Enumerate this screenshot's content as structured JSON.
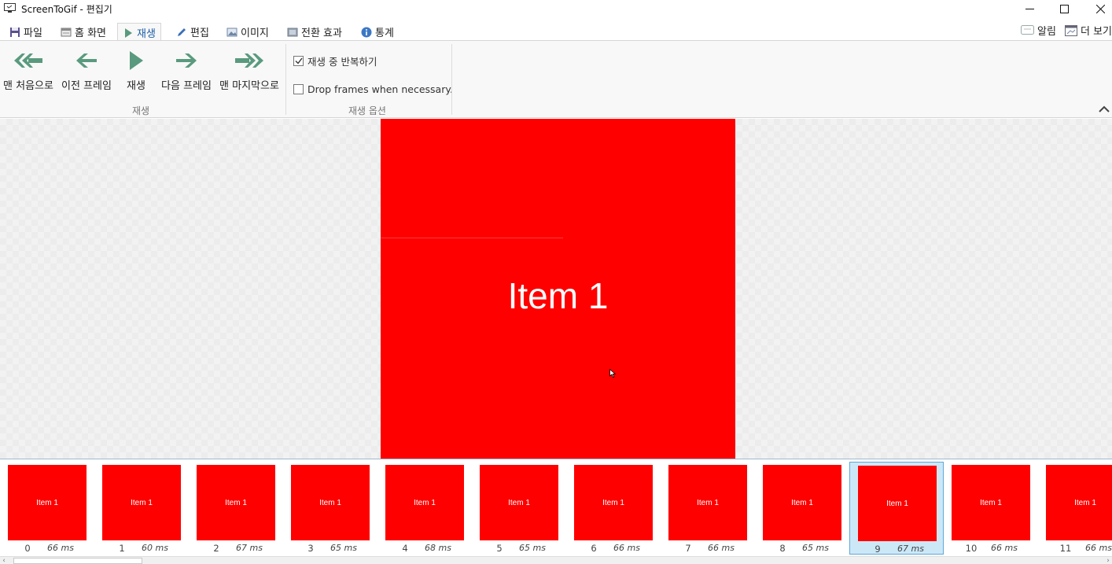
{
  "window": {
    "title": "ScreenToGif - 편집기"
  },
  "tabs": [
    {
      "label": "파일",
      "icon": "save-icon"
    },
    {
      "label": "홈 화면",
      "icon": "home-screen-icon"
    },
    {
      "label": "재생",
      "icon": "play-icon",
      "active": true
    },
    {
      "label": "편집",
      "icon": "pencil-icon"
    },
    {
      "label": "이미지",
      "icon": "image-icon"
    },
    {
      "label": "전환 효과",
      "icon": "transition-icon"
    },
    {
      "label": "통계",
      "icon": "info-icon"
    }
  ],
  "tab_right": {
    "notifications": "알림",
    "more": "더 보기"
  },
  "ribbon": {
    "playback": {
      "first": "맨 처음으로",
      "previous": "이전 프레임",
      "play": "재생",
      "next": "다음 프레임",
      "last": "맨 마지막으로",
      "group_label": "재생"
    },
    "options": {
      "loop_label": "재생 중 반복하기",
      "loop_checked": true,
      "drop_label": "Drop frames when necessary.",
      "drop_checked": false,
      "group_label": "재생 옵션"
    }
  },
  "canvas": {
    "frame_text": "Item 1"
  },
  "frames": [
    {
      "index": "0",
      "duration": "66 ms",
      "text": "Item 1"
    },
    {
      "index": "1",
      "duration": "60 ms",
      "text": "Item 1"
    },
    {
      "index": "2",
      "duration": "67 ms",
      "text": "Item 1"
    },
    {
      "index": "3",
      "duration": "65 ms",
      "text": "Item 1"
    },
    {
      "index": "4",
      "duration": "68 ms",
      "text": "Item 1"
    },
    {
      "index": "5",
      "duration": "65 ms",
      "text": "Item 1"
    },
    {
      "index": "6",
      "duration": "66 ms",
      "text": "Item 1"
    },
    {
      "index": "7",
      "duration": "66 ms",
      "text": "Item 1"
    },
    {
      "index": "8",
      "duration": "65 ms",
      "text": "Item 1"
    },
    {
      "index": "9",
      "duration": "67 ms",
      "text": "Item 1",
      "selected": true
    },
    {
      "index": "10",
      "duration": "66 ms",
      "text": "Item 1"
    },
    {
      "index": "11",
      "duration": "66 ms",
      "text": "Item 1"
    }
  ],
  "colors": {
    "frame_red": "#ff0000",
    "accent_green": "#5a9a7e",
    "selected_tab_text": "#1d5da8",
    "selected_frame_bg": "#cce8f7"
  }
}
